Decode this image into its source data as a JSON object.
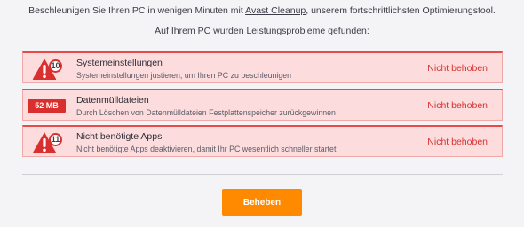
{
  "intro": {
    "line1_before": "Beschleunigen Sie Ihren PC in wenigen Minuten mit ",
    "line1_link": "Avast Cleanup",
    "line1_after": ", unserem fortschrittlichsten Optimierungstool.",
    "line2": "Auf Ihrem PC wurden Leistungsprobleme gefunden:"
  },
  "issues": [
    {
      "badge": "10",
      "icon": "warning-triangle-icon",
      "title": "Systemeinstellungen",
      "description": "Systemeinstellungen justieren, um Ihren PC zu beschleunigen",
      "status": "Nicht behoben"
    },
    {
      "badge": "52 MB",
      "title": "Datenmülldateien",
      "description": "Durch Löschen von Datenmülldateien Festplattenspeicher zurückgewinnen",
      "status": "Nicht behoben"
    },
    {
      "badge": "11",
      "icon": "warning-triangle-icon",
      "title": "Nicht benötigte Apps",
      "description": "Nicht benötigte Apps deaktivieren, damit Ihr PC wesentlich schneller startet",
      "status": "Nicht behoben"
    }
  ],
  "action": {
    "fix_label": "Beheben"
  },
  "colors": {
    "background": "#f4f3f6",
    "issue_background": "#fcdcdc",
    "issue_border": "#e84a4a",
    "alert_red": "#d9302f",
    "button_orange": "#ff8a00"
  }
}
